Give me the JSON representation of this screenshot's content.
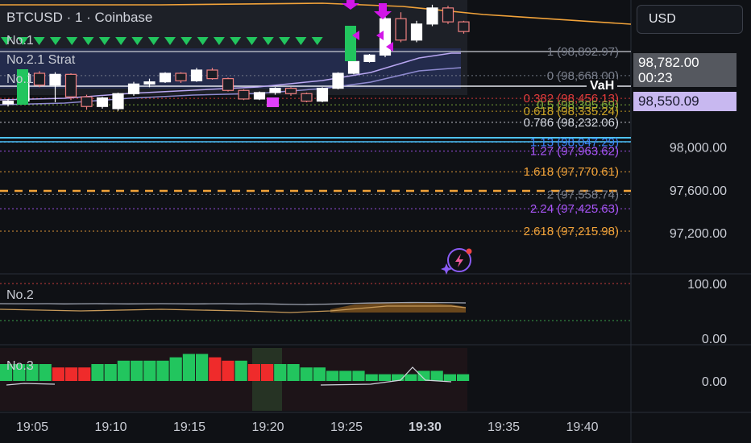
{
  "header": {
    "symbol_title": "BTCUSD · 1 · Coinbase",
    "legend_no1_top": "No.1",
    "legend_no2_strat": "No.2.1 Strat",
    "legend_no1_bottom": "No.1"
  },
  "currency_button": "USD",
  "price_tags": {
    "current_price": "98,782.00",
    "countdown": "00:23",
    "vah_label": "VaH",
    "vah_price": "98,550.09"
  },
  "colors": {
    "background": "#0f1115",
    "up_candle": "#ffffff",
    "down_candle": "#f08080",
    "green": "#22c55e",
    "red": "#ef2b2b",
    "purple_marker": "#d216e8",
    "orange_line": "#f2a33a"
  },
  "chart_data": [
    {
      "type": "candlestick",
      "symbol": "BTCUSD",
      "interval": "1",
      "exchange": "Coinbase",
      "x": [
        "19:01",
        "19:02",
        "19:03",
        "19:04",
        "19:05",
        "19:06",
        "19:07",
        "19:08",
        "19:09",
        "19:10",
        "19:11",
        "19:12",
        "19:13",
        "19:14",
        "19:15",
        "19:16",
        "19:17",
        "19:18",
        "19:19",
        "19:20",
        "19:21",
        "19:22",
        "19:23",
        "19:24",
        "19:25",
        "19:26",
        "19:27",
        "19:28",
        "19:29",
        "19:30"
      ],
      "ohlc": [
        [
          98405,
          98450,
          98380,
          98430
        ],
        [
          98430,
          98720,
          98400,
          98690
        ],
        [
          98690,
          98710,
          98560,
          98580
        ],
        [
          98580,
          98700,
          98420,
          98680
        ],
        [
          98680,
          98690,
          98440,
          98470
        ],
        [
          98470,
          98490,
          98350,
          98380
        ],
        [
          98380,
          98470,
          98360,
          98460
        ],
        [
          98360,
          98510,
          98340,
          98500
        ],
        [
          98500,
          98610,
          98480,
          98590
        ],
        [
          98590,
          98640,
          98560,
          98610
        ],
        [
          98610,
          98700,
          98600,
          98690
        ],
        [
          98690,
          98700,
          98600,
          98620
        ],
        [
          98620,
          98740,
          98610,
          98720
        ],
        [
          98720,
          98740,
          98630,
          98640
        ],
        [
          98640,
          98650,
          98520,
          98530
        ],
        [
          98530,
          98540,
          98440,
          98450
        ],
        [
          98450,
          98520,
          98440,
          98510
        ],
        [
          98510,
          98560,
          98490,
          98550
        ],
        [
          98550,
          98560,
          98480,
          98500
        ],
        [
          98500,
          98510,
          98420,
          98430
        ],
        [
          98430,
          98560,
          98420,
          98550
        ],
        [
          98550,
          98700,
          98540,
          98690
        ],
        [
          98690,
          98810,
          98680,
          98800
        ],
        [
          98800,
          98870,
          98790,
          98860
        ],
        [
          98860,
          99250,
          98840,
          99200
        ],
        [
          99200,
          99260,
          98980,
          99000
        ],
        [
          99000,
          99180,
          98980,
          99150
        ],
        [
          99150,
          99330,
          99130,
          99300
        ],
        [
          99300,
          99320,
          99150,
          99170
        ],
        [
          99170,
          99180,
          99060,
          99080
        ]
      ],
      "price_axis_ticks": [
        "98,000.00",
        "97,600.00",
        "97,200.00"
      ],
      "time_axis_ticks": [
        "19:05",
        "19:10",
        "19:15",
        "19:20",
        "19:25",
        "19:30",
        "19:35",
        "19:40"
      ],
      "fibonacci_levels": [
        {
          "ratio": "1",
          "price": "98,892.97",
          "color": "#7a7f8c"
        },
        {
          "ratio": "0",
          "price": "98,668.00",
          "color": "#7a7f8c"
        },
        {
          "ratio": "0.382",
          "price": "98,456.13",
          "color": "#e03b3b"
        },
        {
          "ratio": "0.5",
          "price": "98,395.69",
          "color": "#7fae3a"
        },
        {
          "ratio": "0.618",
          "price": "98,335.24",
          "color": "#c9a227"
        },
        {
          "ratio": "0.786",
          "price": "98,232.06",
          "color": "#d1d4dc"
        },
        {
          "ratio": "1.13",
          "price": "98,047.29",
          "color": "#3b82f6"
        },
        {
          "ratio": "1.27",
          "price": "97,963.62",
          "color": "#a855f7"
        },
        {
          "ratio": "1.618",
          "price": "97,770.61",
          "color": "#f2a33a"
        },
        {
          "ratio": "2",
          "price": "97,558.74",
          "color": "#7a7f8c"
        },
        {
          "ratio": "2.24",
          "price": "97,425.63",
          "color": "#a855f7"
        },
        {
          "ratio": "2.618",
          "price": "97,215.98",
          "color": "#f2a33a"
        }
      ]
    },
    {
      "type": "line",
      "indicator": "No.2",
      "range": [
        0,
        100
      ],
      "axis_ticks": [
        "100.00",
        "0.00"
      ],
      "values": [
        52,
        51,
        51,
        52,
        50,
        51,
        52,
        51,
        50,
        51,
        52,
        51,
        50,
        51,
        52,
        50,
        51,
        49,
        46,
        44,
        47,
        50,
        55,
        58,
        60,
        62,
        63,
        62,
        61,
        59
      ]
    },
    {
      "type": "bar",
      "indicator": "No.3",
      "axis_ticks": [
        "0.00"
      ],
      "values": [
        5,
        5,
        5,
        5,
        4,
        4,
        4,
        5,
        5,
        6,
        6,
        6,
        6,
        7,
        8,
        8,
        7,
        6,
        6,
        5,
        5,
        5,
        5,
        4,
        4,
        3,
        3,
        3,
        2,
        2,
        2,
        2,
        3,
        3,
        2,
        2
      ],
      "colors": [
        "g",
        "g",
        "g",
        "g",
        "r",
        "r",
        "r",
        "g",
        "g",
        "g",
        "g",
        "g",
        "g",
        "g",
        "g",
        "g",
        "r",
        "r",
        "g",
        "r",
        "r",
        "g",
        "g",
        "g",
        "g",
        "g",
        "g",
        "g",
        "g",
        "g",
        "g",
        "g",
        "g",
        "g",
        "g",
        "g"
      ]
    }
  ]
}
